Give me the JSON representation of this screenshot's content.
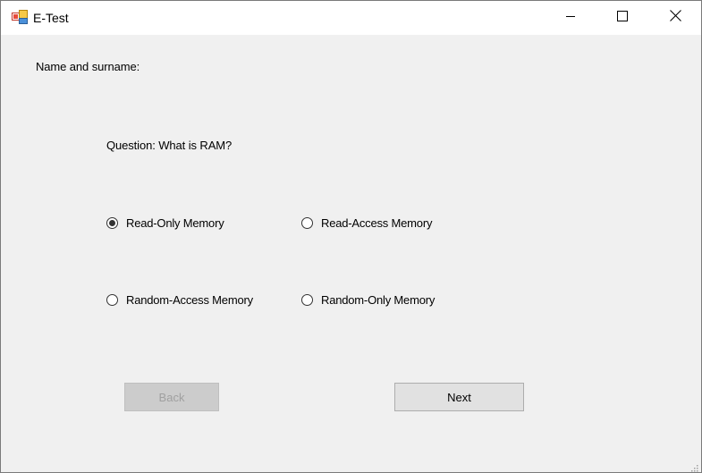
{
  "window": {
    "title": "E-Test",
    "app_icon": "form-app-icon",
    "controls": {
      "minimize_icon": "minimize-icon",
      "maximize_icon": "maximize-icon",
      "close_icon": "close-icon"
    }
  },
  "form": {
    "name_label": "Name and surname:",
    "question_label": "Question:  What is RAM?",
    "options": [
      {
        "label": "Read-Only Memory",
        "checked": true
      },
      {
        "label": "Read-Access Memory",
        "checked": false
      },
      {
        "label": "Random-Access Memory",
        "checked": false
      },
      {
        "label": "Random-Only Memory",
        "checked": false
      }
    ],
    "back_label": "Back",
    "back_enabled": false,
    "next_label": "Next"
  },
  "colors": {
    "background": "#f0f0f0",
    "titlebar": "#ffffff",
    "button_face": "#e1e1e1",
    "disabled_button": "#cccccc"
  }
}
